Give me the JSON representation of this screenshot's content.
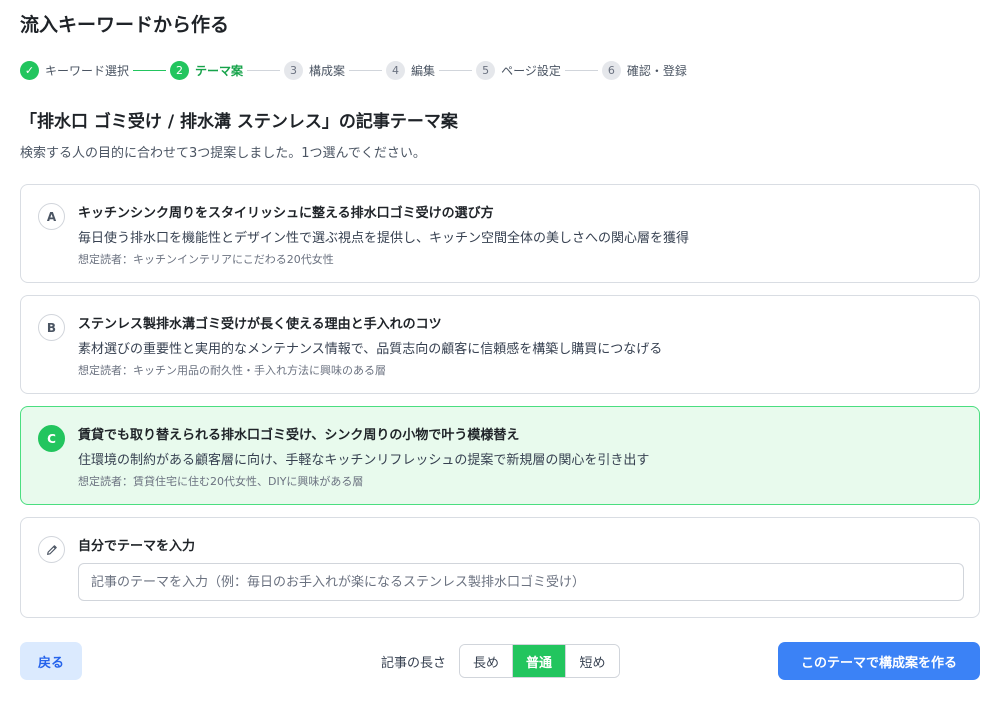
{
  "page": {
    "title": "流入キーワードから作る"
  },
  "stepper": {
    "steps": [
      {
        "number": "✓",
        "label": "キーワード選択",
        "state": "done"
      },
      {
        "number": "2",
        "label": "テーマ案",
        "state": "current"
      },
      {
        "number": "3",
        "label": "構成案",
        "state": "todo"
      },
      {
        "number": "4",
        "label": "編集",
        "state": "todo"
      },
      {
        "number": "5",
        "label": "ページ設定",
        "state": "todo"
      },
      {
        "number": "6",
        "label": "確認・登録",
        "state": "todo"
      }
    ]
  },
  "section": {
    "title": "「排水口 ゴミ受け / 排水溝 ステンレス」の記事テーマ案",
    "subtitle": "検索する人の目的に合わせて3つ提案しました。1つ選んでください。"
  },
  "options": [
    {
      "badge": "A",
      "title": "キッチンシンク周りをスタイリッシュに整える排水口ゴミ受けの選び方",
      "description": "毎日使う排水口を機能性とデザイン性で選ぶ視点を提供し、キッチン空間全体の美しさへの関心層を獲得",
      "reader": "想定読者：キッチンインテリアにこだわる20代女性",
      "selected": false
    },
    {
      "badge": "B",
      "title": "ステンレス製排水溝ゴミ受けが長く使える理由と手入れのコツ",
      "description": "素材選びの重要性と実用的なメンテナンス情報で、品質志向の顧客に信頼感を構築し購買につなげる",
      "reader": "想定読者：キッチン用品の耐久性・手入れ方法に興味のある層",
      "selected": false
    },
    {
      "badge": "C",
      "title": "賃貸でも取り替えられる排水口ゴミ受け、シンク周りの小物で叶う模様替え",
      "description": "住環境の制約がある顧客層に向け、手軽なキッチンリフレッシュの提案で新規層の関心を引き出す",
      "reader": "想定読者：賃貸住宅に住む20代女性、DIYに興味がある層",
      "selected": true
    }
  ],
  "custom": {
    "icon": "pencil-icon",
    "title": "自分でテーマを入力",
    "value": "",
    "placeholder": "記事のテーマを入力（例：毎日のお手入れが楽になるステンレス製排水口ゴミ受け）"
  },
  "footer": {
    "back_label": "戻る",
    "length_label": "記事の長さ",
    "length_options": [
      {
        "label": "長め",
        "active": false
      },
      {
        "label": "普通",
        "active": true
      },
      {
        "label": "短め",
        "active": false
      }
    ],
    "submit_label": "このテーマで構成案を作る"
  },
  "colors": {
    "accent_green": "#22c55e",
    "selected_bg": "#e8faed",
    "primary_blue": "#3b82f6",
    "back_bg": "#dbeafe"
  }
}
